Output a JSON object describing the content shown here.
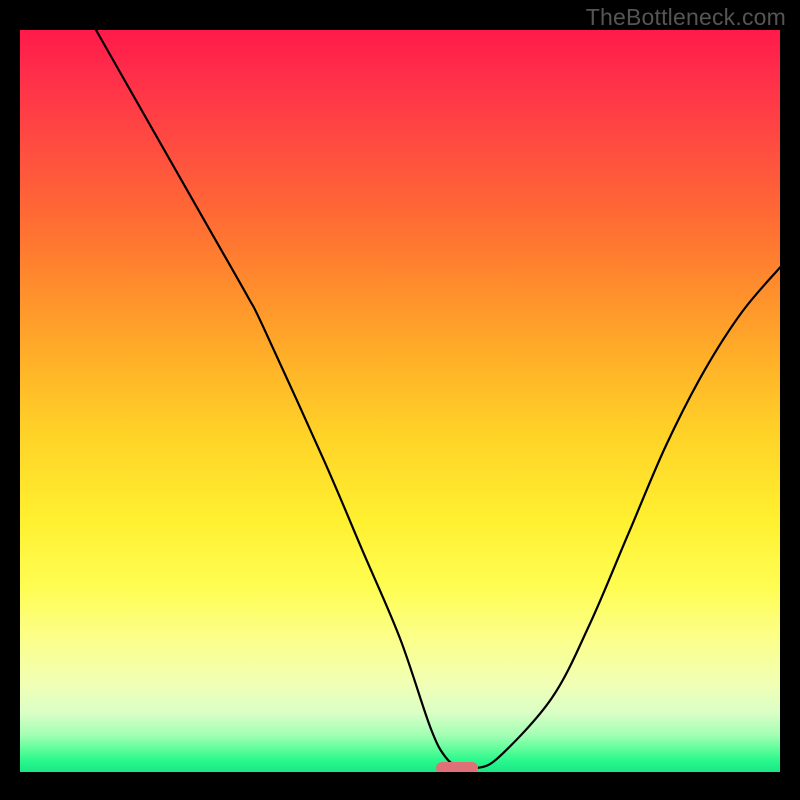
{
  "watermark": "TheBottleneck.com",
  "chart_data": {
    "type": "line",
    "title": "",
    "xlabel": "",
    "ylabel": "",
    "xlim": [
      0,
      100
    ],
    "ylim": [
      0,
      100
    ],
    "grid": false,
    "series": [
      {
        "name": "bottleneck-curve",
        "x": [
          10,
          15,
          20,
          25,
          30,
          32,
          40,
          45,
          50,
          54,
          56,
          58,
          60,
          63,
          70,
          75,
          80,
          85,
          90,
          95,
          100
        ],
        "y": [
          100,
          91,
          82,
          73,
          64,
          60,
          42,
          30,
          18,
          6,
          2,
          0.5,
          0.5,
          2,
          10,
          20,
          32,
          44,
          54,
          62,
          68
        ]
      }
    ],
    "marker": {
      "x": 57.5,
      "y": 0.5,
      "color": "#e07078"
    },
    "background_gradient": {
      "top_color": "#ff1a4a",
      "bottom_color": "#1be686",
      "stops": [
        "red",
        "orange",
        "yellow",
        "green"
      ]
    }
  }
}
